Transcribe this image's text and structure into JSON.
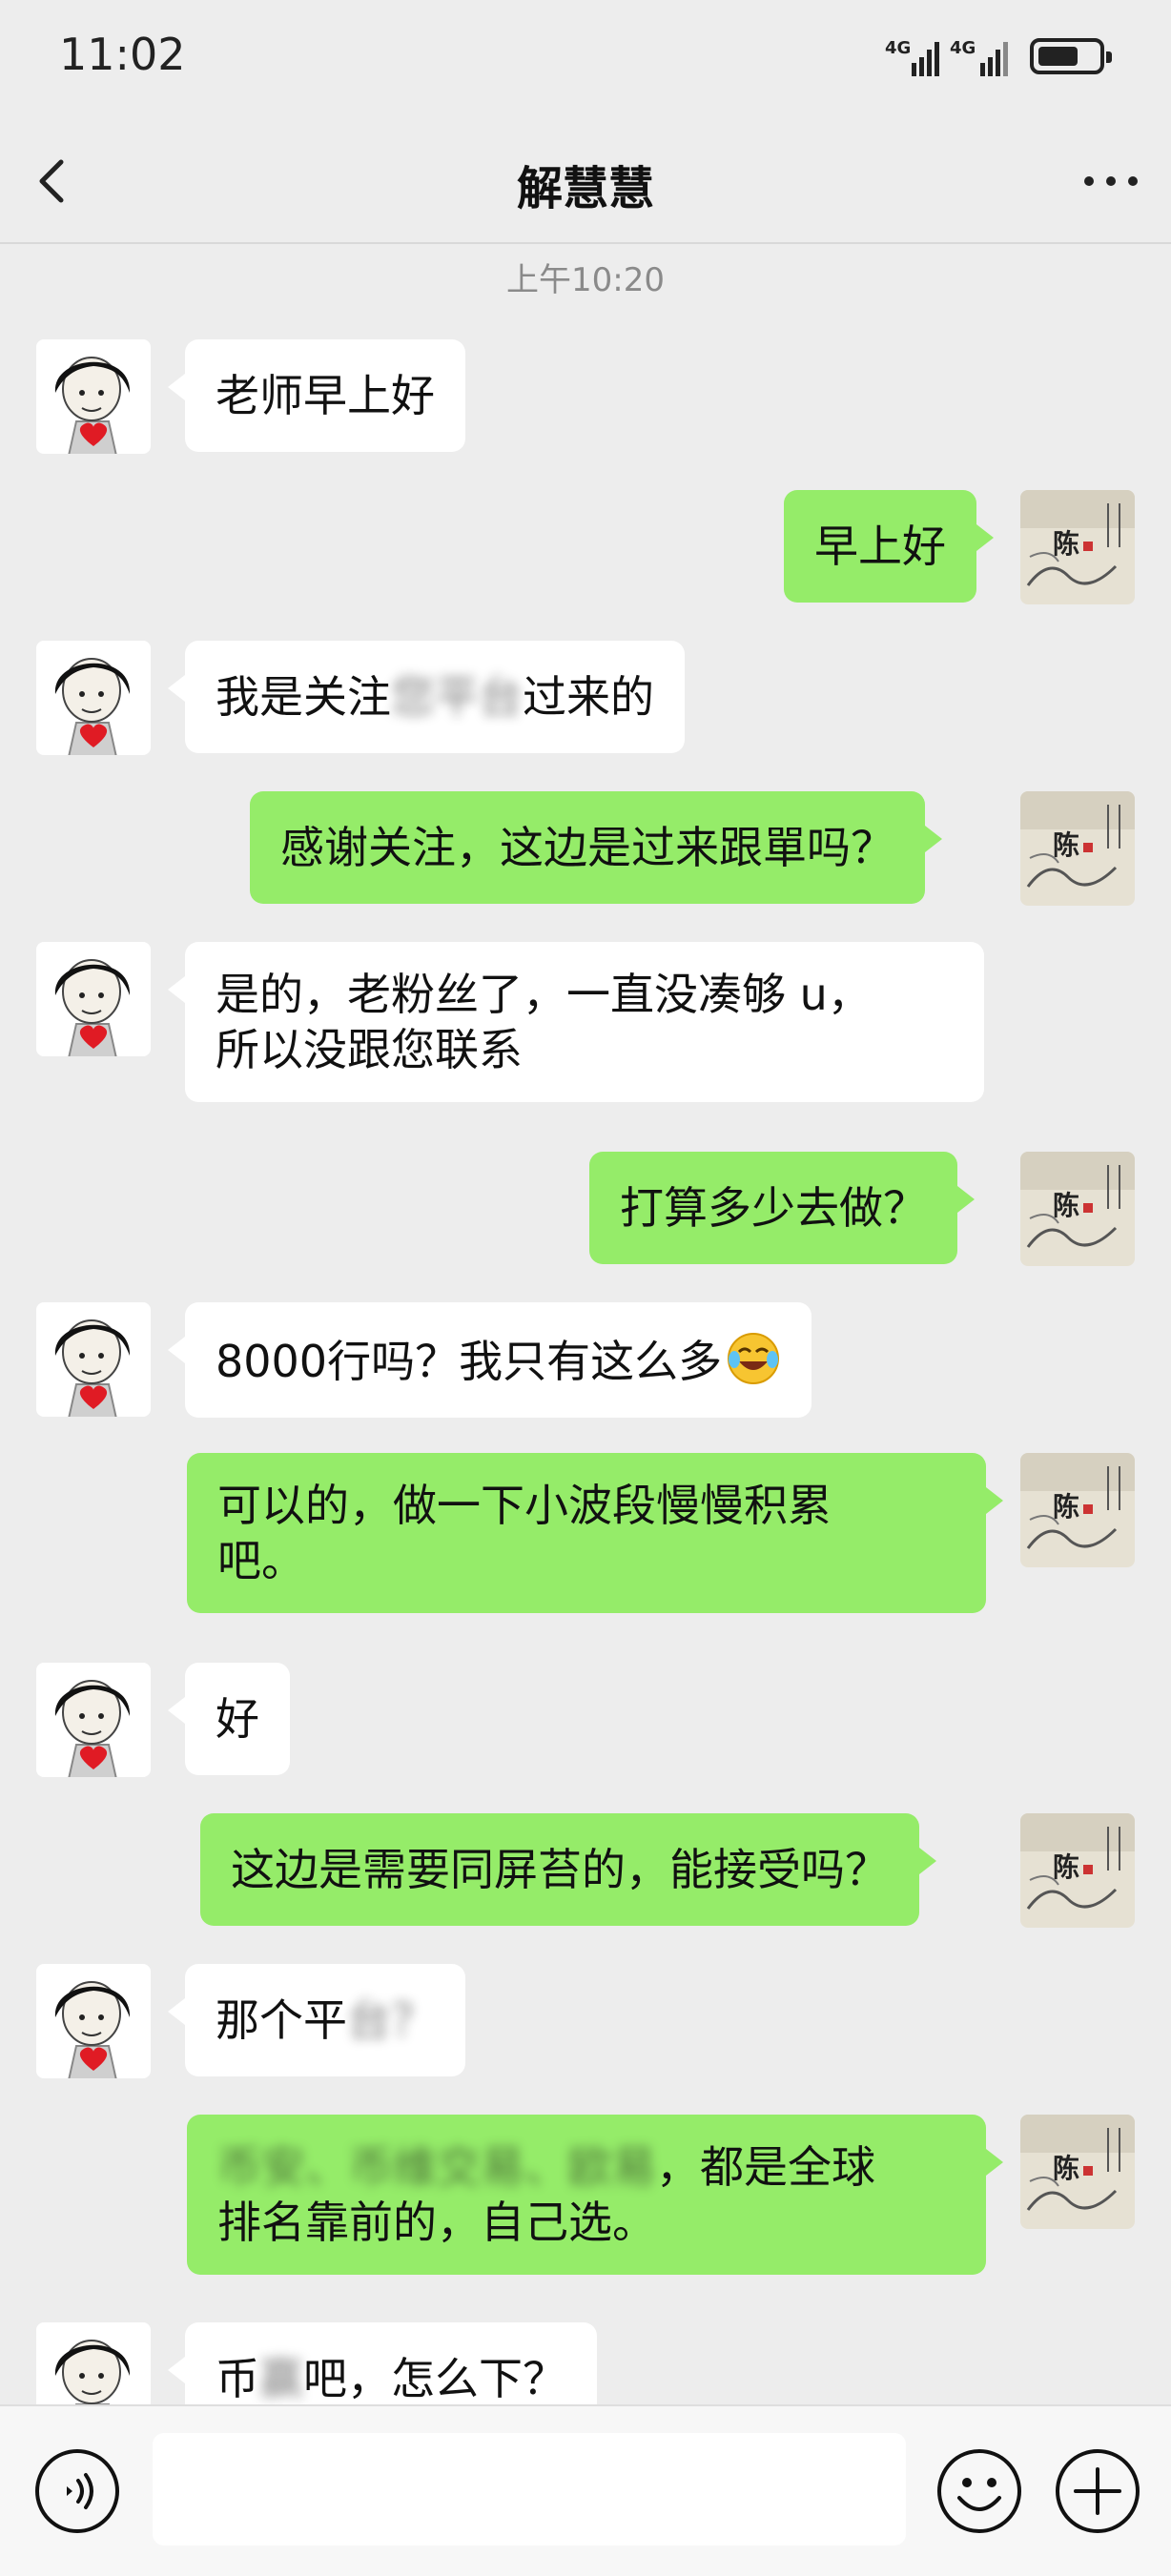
{
  "status_bar": {
    "time": "11:02",
    "net1": "4G",
    "net2": "4G"
  },
  "header": {
    "title": "解慧慧"
  },
  "timestamp": "上午10:20",
  "messages": [
    {
      "side": "in",
      "text": "老师早上好"
    },
    {
      "side": "out",
      "text": "早上好"
    },
    {
      "side": "in",
      "parts": [
        "我是关注",
        "您平台",
        "过来的"
      ]
    },
    {
      "side": "out",
      "text": "感谢关注，这边是过来跟單吗？"
    },
    {
      "side": "in",
      "line1": "是的，老粉丝了，一直没凑够 u，",
      "line2": "所以没跟您联系"
    },
    {
      "side": "out",
      "text": "打算多少去做？"
    },
    {
      "side": "in",
      "text": "8000行吗？我只有这么多"
    },
    {
      "side": "out",
      "line1": "可以的，做一下小波段慢慢积累",
      "line2": "吧。"
    },
    {
      "side": "in",
      "text": "好"
    },
    {
      "side": "out",
      "text": "这边是需要同屏苔的，能接受吗？"
    },
    {
      "side": "in",
      "parts": [
        "那个平",
        "台？"
      ]
    },
    {
      "side": "out",
      "blur1": "币安、币维交易、欧易",
      "line1_rest": "，都是全球",
      "line2": "排名靠前的，自己选。"
    },
    {
      "side": "in",
      "parts": [
        "币",
        "赢",
        "吧，怎么下？"
      ]
    }
  ],
  "colors": {
    "background": "#ededed",
    "outgoing": "#95ec69",
    "incoming": "#ffffff"
  },
  "icons": [
    "back-arrow-icon",
    "more-icon",
    "voice-icon",
    "emoji-icon",
    "plus-icon"
  ]
}
